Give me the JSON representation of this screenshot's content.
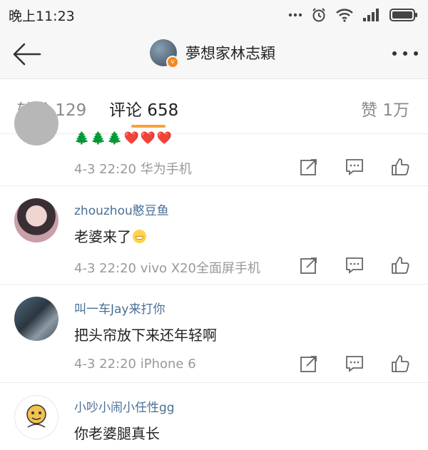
{
  "status_bar": {
    "time": "晚上11:23",
    "icons": [
      "more-dots-icon",
      "alarm-icon",
      "wifi-icon",
      "signal-icon",
      "battery-icon"
    ]
  },
  "nav": {
    "title": "夢想家林志穎",
    "verified_badge": "v"
  },
  "tabs": {
    "repost": "转发 129",
    "comments": "评论 658",
    "likes": "赞 1万",
    "active": "comments",
    "accent_color": "#f4a43a"
  },
  "comments": [
    {
      "text_emoji": "🌲🌲🌲❤️❤️❤️",
      "time": "4-3 22:20",
      "device": "华为手机",
      "avatar_icon": "avatar-partial-icon"
    },
    {
      "username": "zhouzhou憨豆鱼",
      "text": "老婆来了",
      "time": "4-3 22:20",
      "device": "vivo X20全面屏手机",
      "avatar_icon": "avatar-girl-icon"
    },
    {
      "username": "叫一车Jay来打你",
      "text": "把头帘放下来还年轻啊",
      "time": "4-3 22:20",
      "device": "iPhone 6",
      "avatar_icon": "avatar-group-photo-icon"
    },
    {
      "username": "小吵小闹小任性gg",
      "text": "你老婆腿真长",
      "avatar_icon": "avatar-cartoon-icon"
    }
  ],
  "colors": {
    "username": "#4a6f96",
    "meta": "#999999",
    "header_bg": "#f7f7f7"
  }
}
